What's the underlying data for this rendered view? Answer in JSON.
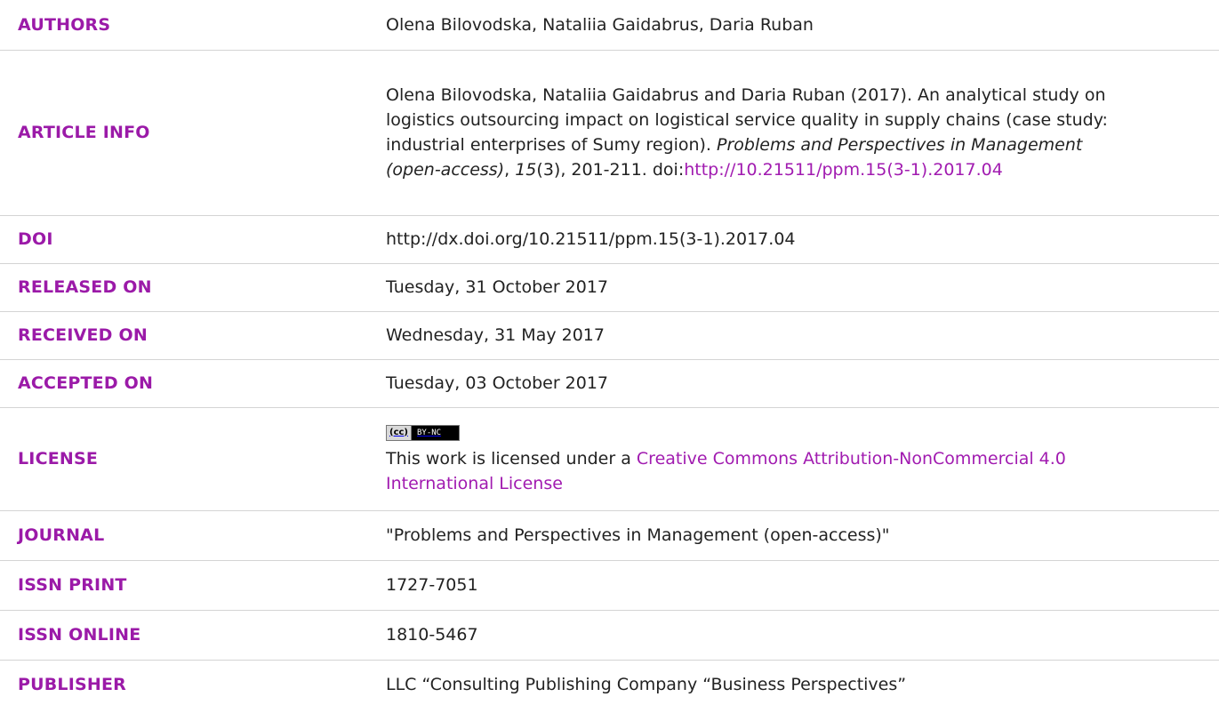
{
  "rows": {
    "authors": {
      "label": "AUTHORS",
      "value": "Olena Bilovodska, Nataliia Gaidabrus, Daria Ruban"
    },
    "article_info": {
      "label": "ARTICLE INFO",
      "text_before": "Olena Bilovodska, Nataliia Gaidabrus and Daria Ruban (2017). An analytical study on logistics outsourcing impact on logistical service quality in supply chains (case study: industrial enterprises of Sumy region). ",
      "journal_italic": "Problems and Perspectives in Management (open-access)",
      "comma": ", ",
      "volume_italic": "15",
      "issue_pages": "(3), 201-211. doi:",
      "doi_link": "http://10.21511/ppm.15(3-1).2017.04"
    },
    "doi": {
      "label": "DOI",
      "value": "http://dx.doi.org/10.21511/ppm.15(3-1).2017.04"
    },
    "released_on": {
      "label": "RELEASED ON",
      "value": "Tuesday, 31 October 2017"
    },
    "received_on": {
      "label": "RECEIVED ON",
      "value": "Wednesday, 31 May 2017"
    },
    "accepted_on": {
      "label": "ACCEPTED ON",
      "value": "Tuesday, 03 October 2017"
    },
    "license": {
      "label": "LICENSE",
      "badge_mark": "(cc)",
      "badge_text": "BY-NC",
      "text_before": "This work is licensed under a ",
      "link_text": "Creative Commons Attribution-NonCommercial 4.0 International License"
    },
    "journal": {
      "label": "JOURNAL",
      "value": "\"Problems and Perspectives in Management (open-access)\""
    },
    "issn_print": {
      "label": "ISSN PRINT",
      "value": "1727-7051"
    },
    "issn_online": {
      "label": "ISSN ONLINE",
      "value": "1810-5467"
    },
    "publisher": {
      "label": "PUBLISHER",
      "value": "LLC “Consulting Publishing Company “Business Perspectives”"
    }
  },
  "colors": {
    "label": "#9b1aa8",
    "link": "#a11bb0",
    "text": "#222222",
    "divider": "#d4d4d4"
  }
}
